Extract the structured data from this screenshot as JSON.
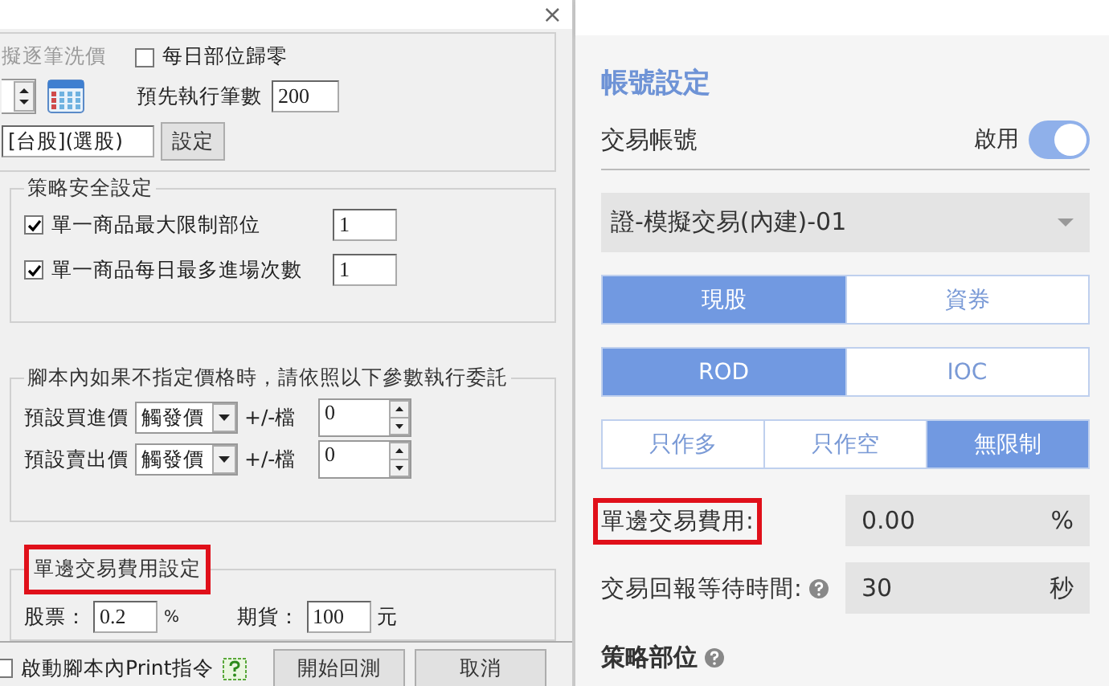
{
  "left_dialog": {
    "close": "×",
    "general": {
      "slippage_label": "擬逐筆洗價",
      "slippage_disabled": true,
      "daily_reset": {
        "label": "每日部位歸零",
        "checked": false
      },
      "preload_label": "預先執行筆數",
      "preload_value": "200",
      "market_value": "[台股](選股)",
      "set_button": "設定"
    },
    "safety": {
      "title": "策略安全設定",
      "rows": [
        {
          "label": "單一商品最大限制部位",
          "checked": true,
          "value": "1"
        },
        {
          "label": "單一商品每日最多進場次數",
          "checked": true,
          "value": "1"
        }
      ]
    },
    "price": {
      "title": "腳本內如果不指定價格時，請依照以下參數執行委託",
      "rows": [
        {
          "label": "預設買進價",
          "select": "觸發價",
          "tick_label": "+/-檔",
          "value": "0"
        },
        {
          "label": "預設賣出價",
          "select": "觸發價",
          "tick_label": "+/-檔",
          "value": "0"
        }
      ]
    },
    "fee": {
      "title": "單邊交易費用設定",
      "highlighted": true,
      "stock_label": "股票：",
      "stock_value": "0.2",
      "stock_unit": "%",
      "futures_label": "期貨：",
      "futures_value": "100",
      "futures_unit": "元"
    },
    "footer": {
      "print_label": "啟動腳本內Print指令",
      "print_checked": false,
      "buttons": [
        "開始回測",
        "取消"
      ]
    }
  },
  "right_panel": {
    "title": "帳號設定",
    "account": {
      "label": "交易帳號",
      "enable_label": "啟用",
      "on": true
    },
    "account_select": "證-模擬交易(內建)-01",
    "segments": [
      [
        {
          "label": "現股",
          "selected": true
        },
        {
          "label": "資券",
          "selected": false
        }
      ],
      [
        {
          "label": "ROD",
          "selected": true
        },
        {
          "label": "IOC",
          "selected": false
        }
      ],
      [
        {
          "label": "只作多",
          "selected": false
        },
        {
          "label": "只作空",
          "selected": false
        },
        {
          "label": "無限制",
          "selected": true
        }
      ]
    ],
    "fields": [
      {
        "label": "單邊交易費用:",
        "highlighted": true,
        "help": false,
        "value": "0.00",
        "unit": "%"
      },
      {
        "label": "交易回報等待時間:",
        "highlighted": false,
        "help": true,
        "value": "30",
        "unit": "秒"
      }
    ],
    "section_title": "策略部位"
  }
}
